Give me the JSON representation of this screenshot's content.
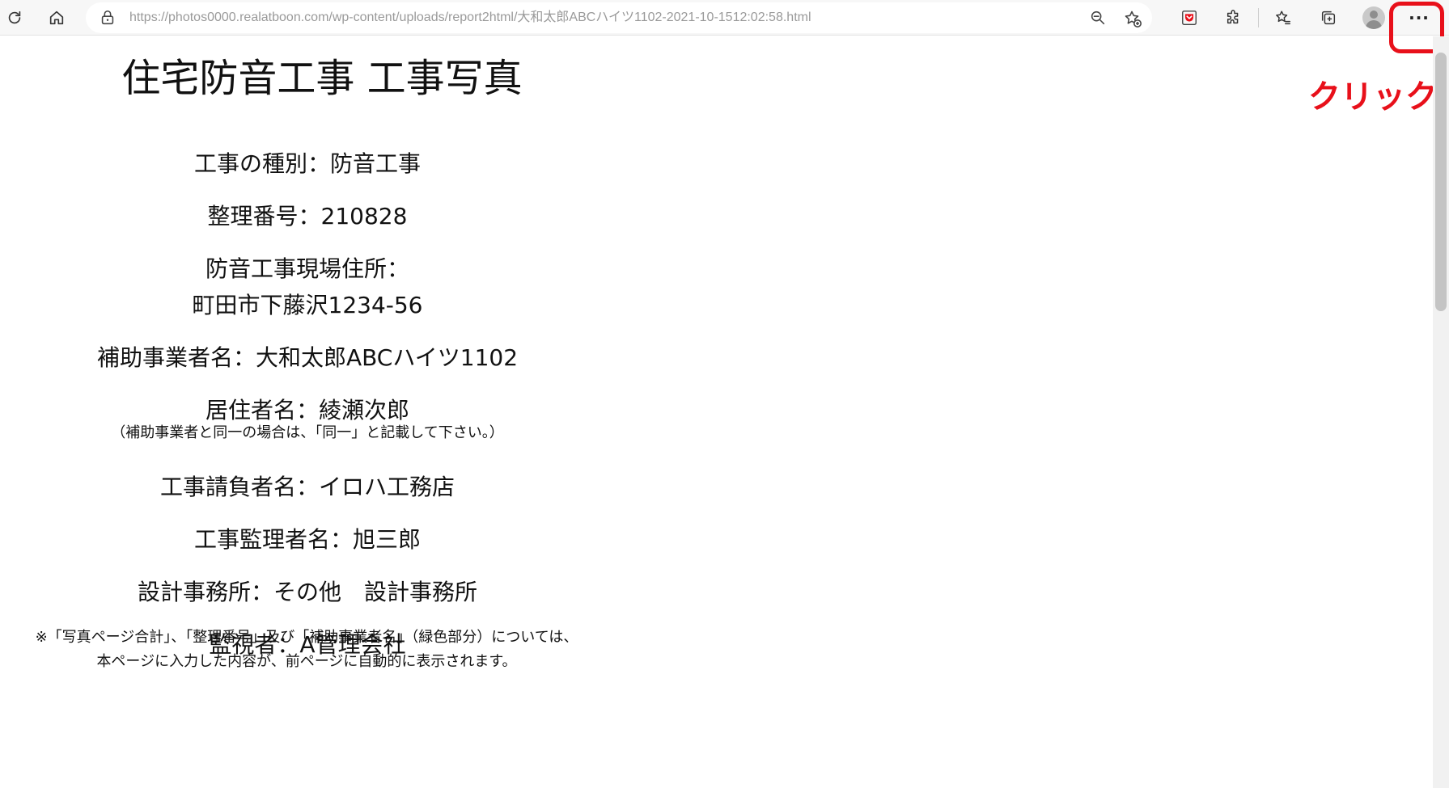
{
  "browser": {
    "url": "https://photos0000.realatboon.com/wp-content/uploads/report2html/大和太郎ABCハイツ1102-2021-10-1512:02:58.html",
    "more_label": "···",
    "annotation": "クリック",
    "annotation_color": "#e8101a"
  },
  "page": {
    "title": "住宅防音工事 工事写真",
    "fields": {
      "work_type": "工事の種別：防音工事",
      "ref_number": "整理番号：210828",
      "site_address_label": "防音工事現場住所：",
      "site_address": "町田市下藤沢1234-56",
      "subsidy_operator": "補助事業者名：大和太郎ABCハイツ1102",
      "resident": "居住者名：綾瀬次郎",
      "resident_note": "（補助事業者と同一の場合は、「同一」と記載して下さい。）",
      "contractor": "工事請負者名：イロハ工務店",
      "supervisor": "工事監理者名：旭三郎",
      "design_office": "設計事務所：その他　設計事務所",
      "inspector": "監視者：A管理会社"
    },
    "footer_note_line1": "※「写真ページ合計」、「整理番号」及び「補助事業者名」（緑色部分）については、",
    "footer_note_line2": "本ページに入力した内容が、前ページに自動的に表示されます。"
  }
}
